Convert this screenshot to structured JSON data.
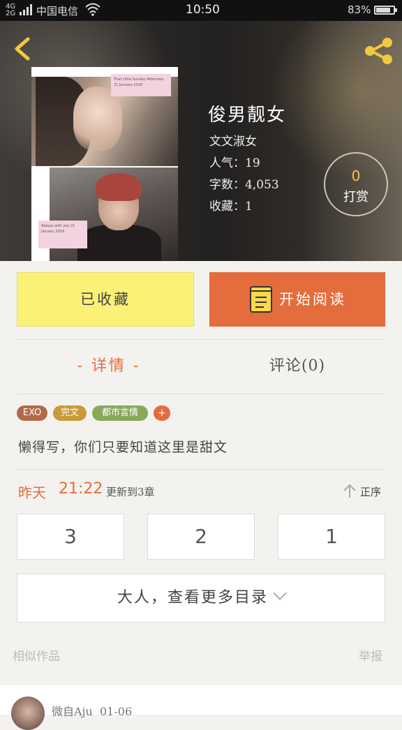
{
  "status_bar": {
    "signal_top": "4G",
    "signal_bottom": "2G",
    "carrier": "中国电信",
    "time": "10:50",
    "battery": "83%",
    "battery_level": 0.83
  },
  "book": {
    "title": "俊男靓女",
    "author": "文文淑女",
    "popularity": "人气：19",
    "word_count": "字数：4,053",
    "favorites": "收藏：1",
    "cover_caption_top": "That Little Sunday Afternoon 21 January 2018",
    "cover_caption_bottom": "Always with you 21 January 2018"
  },
  "tip": {
    "count": "0",
    "label": "打赏"
  },
  "actions": {
    "collected": "已收藏",
    "start_reading": "开始阅读"
  },
  "tabs": {
    "detail": "- 详情 -",
    "comments": "评论(0)"
  },
  "tags": [
    {
      "label": "EXO",
      "color": "#b06a4a"
    },
    {
      "label": "完文",
      "color": "#c99a3a"
    },
    {
      "label": "都市言情",
      "color": "#8aa85a"
    }
  ],
  "tag_add": "+",
  "description": "懒得写，你们只要知道这里是甜文",
  "update": {
    "day": "昨天",
    "time": "21:22",
    "text": "更新到3章",
    "sort_label": "正序"
  },
  "chapters": [
    "3",
    "2",
    "1"
  ],
  "more_toc": "大人，查看更多目录",
  "footer": {
    "similar": "相似作品",
    "report": "举报"
  },
  "comment_preview": {
    "user": "微自Aju",
    "date": "01-06"
  },
  "colors": {
    "accent": "#e56c3c",
    "collected_bg": "#fbf177",
    "tip_number": "#f0c940"
  }
}
